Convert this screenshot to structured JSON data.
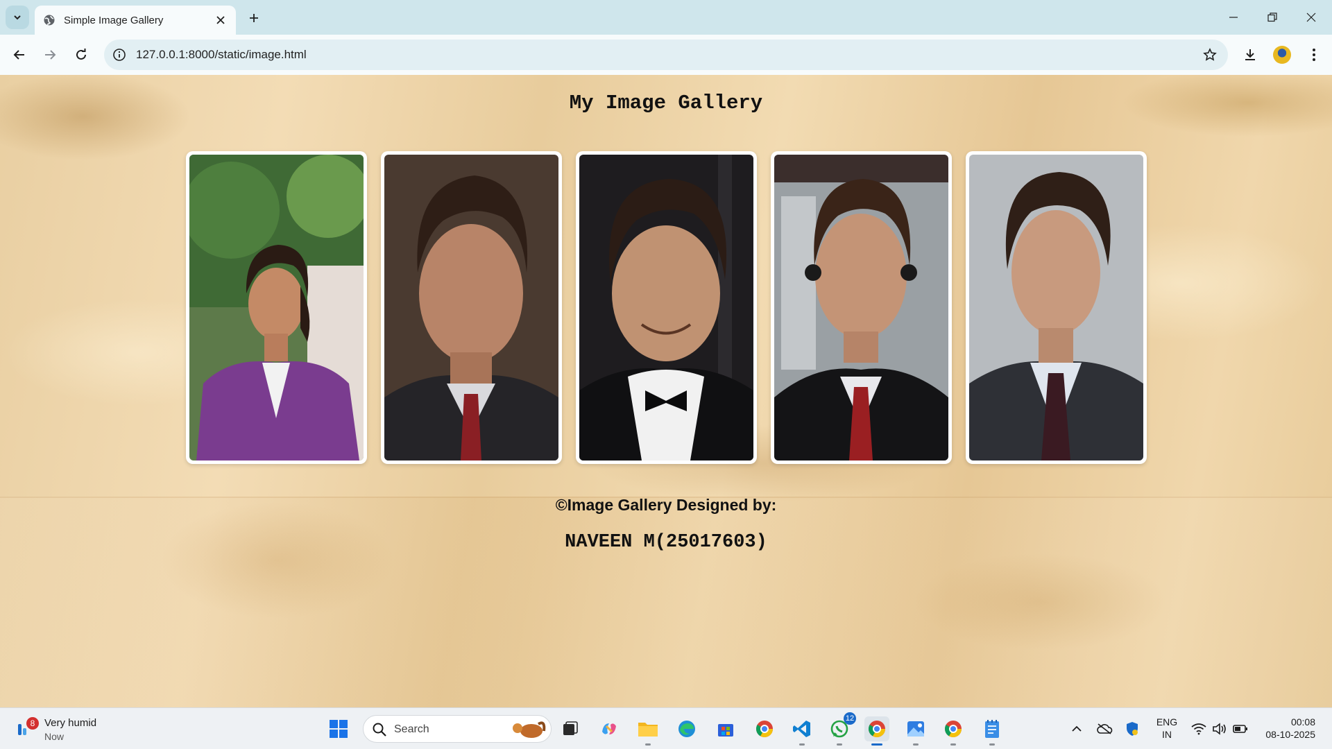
{
  "browser": {
    "tab_title": "Simple Image Gallery",
    "url": "127.0.0.1:8000/static/image.html"
  },
  "page": {
    "heading": "My Image Gallery",
    "footer_credit": "©Image Gallery Designed by:",
    "footer_name": "NAVEEN M(25017603)",
    "images": [
      {
        "name": "photo-purple-shirt",
        "bg": "#5d7a4a",
        "skin": "#c48a66",
        "hair": "#2a1b14",
        "cloth": "#7a3c8f"
      },
      {
        "name": "photo-pinstripe-suit",
        "bg": "#4a3a30",
        "skin": "#b88468",
        "hair": "#2e1e16",
        "cloth": "#252428"
      },
      {
        "name": "photo-tuxedo-smile",
        "bg": "#1e1c1f",
        "skin": "#c09272",
        "hair": "#2b1c15",
        "cloth": "#101012"
      },
      {
        "name": "photo-headphones-suit",
        "bg": "#9aa0a4",
        "skin": "#c49476",
        "hair": "#3a2418",
        "cloth": "#141416"
      },
      {
        "name": "photo-grey-suit",
        "bg": "#b7bbbf",
        "skin": "#c89a7e",
        "hair": "#2f1f17",
        "cloth": "#2e3036"
      }
    ]
  },
  "taskbar": {
    "weather_count": "8",
    "weather_text": "Very humid",
    "weather_time": "Now",
    "search_placeholder": "Search",
    "whatsapp_badge": "12",
    "lang_top": "ENG",
    "lang_bottom": "IN",
    "time": "00:08",
    "date": "08-10-2025"
  },
  "colors": {
    "accent": "#1a6ac9",
    "tabbar": "#cfe6ec",
    "page_background": "#f0d7ac"
  }
}
